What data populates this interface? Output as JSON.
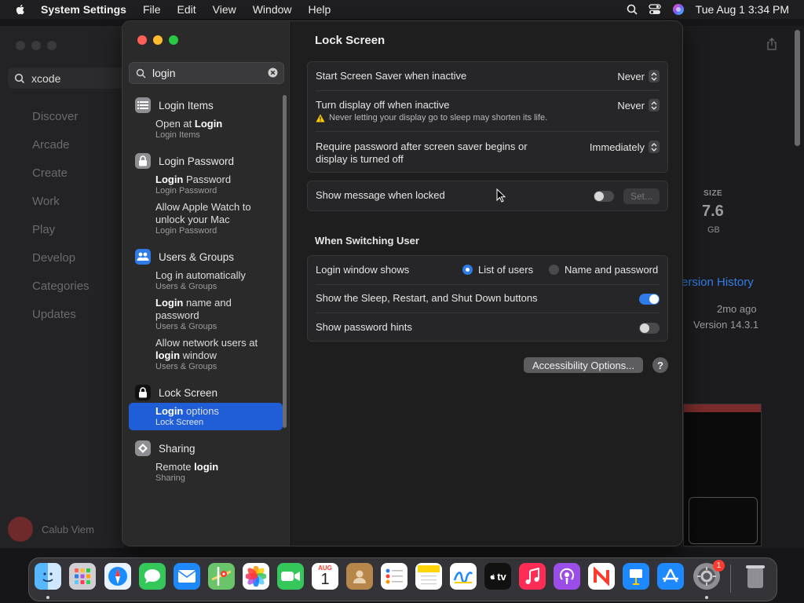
{
  "menubar": {
    "app": "System Settings",
    "items": [
      "File",
      "Edit",
      "View",
      "Window",
      "Help"
    ],
    "clock": "Tue Aug 1  3:34 PM"
  },
  "bg_app": {
    "search_value": "xcode",
    "nav": [
      "Discover",
      "Arcade",
      "Create",
      "Work",
      "Play",
      "Develop",
      "Categories",
      "Updates"
    ],
    "user_name": "Calub Viem",
    "size_label": "SIZE",
    "size_value": "7.6",
    "size_unit": "GB",
    "version_history": "ersion History",
    "ago": "2mo ago",
    "version": "Version 14.3.1"
  },
  "sidebar": {
    "search_value": "login",
    "categories": [
      {
        "label": "Login Items",
        "results": [
          {
            "title_pre": "Open at ",
            "title_bold": "Login",
            "title_post": "",
            "sub": "Login Items"
          }
        ]
      },
      {
        "label": "Login Password",
        "results": [
          {
            "title_pre": "",
            "title_bold": "Login",
            "title_post": " Password",
            "sub": "Login Password"
          },
          {
            "title_pre": "Allow Apple Watch to unlock your Mac",
            "title_bold": "",
            "title_post": "",
            "sub": "Login Password"
          }
        ]
      },
      {
        "label": "Users & Groups",
        "results": [
          {
            "title_pre": "Log in automatically",
            "title_bold": "",
            "title_post": "",
            "sub": "Users & Groups"
          },
          {
            "title_pre": "",
            "title_bold": "Login",
            "title_post": " name and password",
            "sub": "Users & Groups"
          },
          {
            "title_pre": "Allow network users at ",
            "title_bold": "login",
            "title_post": " window",
            "sub": "Users & Groups"
          }
        ]
      },
      {
        "label": "Lock Screen",
        "results": [
          {
            "title_pre": "",
            "title_bold": "Login",
            "title_post": " options",
            "sub": "Lock Screen"
          }
        ]
      },
      {
        "label": "Sharing",
        "results": [
          {
            "title_pre": "Remote ",
            "title_bold": "login",
            "title_post": "",
            "sub": "Sharing"
          }
        ]
      }
    ]
  },
  "main": {
    "title": "Lock Screen",
    "screen_saver": {
      "label": "Start Screen Saver when inactive",
      "value": "Never"
    },
    "display_off": {
      "label": "Turn display off when inactive",
      "value": "Never",
      "warning": "Never letting your display go to sleep may shorten its life."
    },
    "require_password": {
      "label_line1": "Require password after screen saver begins or",
      "label_line2": "display is turned off",
      "value": "Immediately"
    },
    "show_message": {
      "label": "Show message when locked",
      "set_label": "Set..."
    },
    "switching_header": "When Switching User",
    "login_window": {
      "label": "Login window shows",
      "option1": "List of users",
      "option2": "Name and password",
      "selected": "List of users"
    },
    "sleep_buttons": {
      "label": "Show the Sleep, Restart, and Shut Down buttons",
      "on": true
    },
    "password_hints": {
      "label": "Show password hints",
      "on": false
    },
    "accessibility_button": "Accessibility Options...",
    "help_button": "?"
  },
  "dock": {
    "calendar_month": "AUG",
    "calendar_day": "1",
    "tv_label": "tv",
    "settings_badge": "1"
  }
}
